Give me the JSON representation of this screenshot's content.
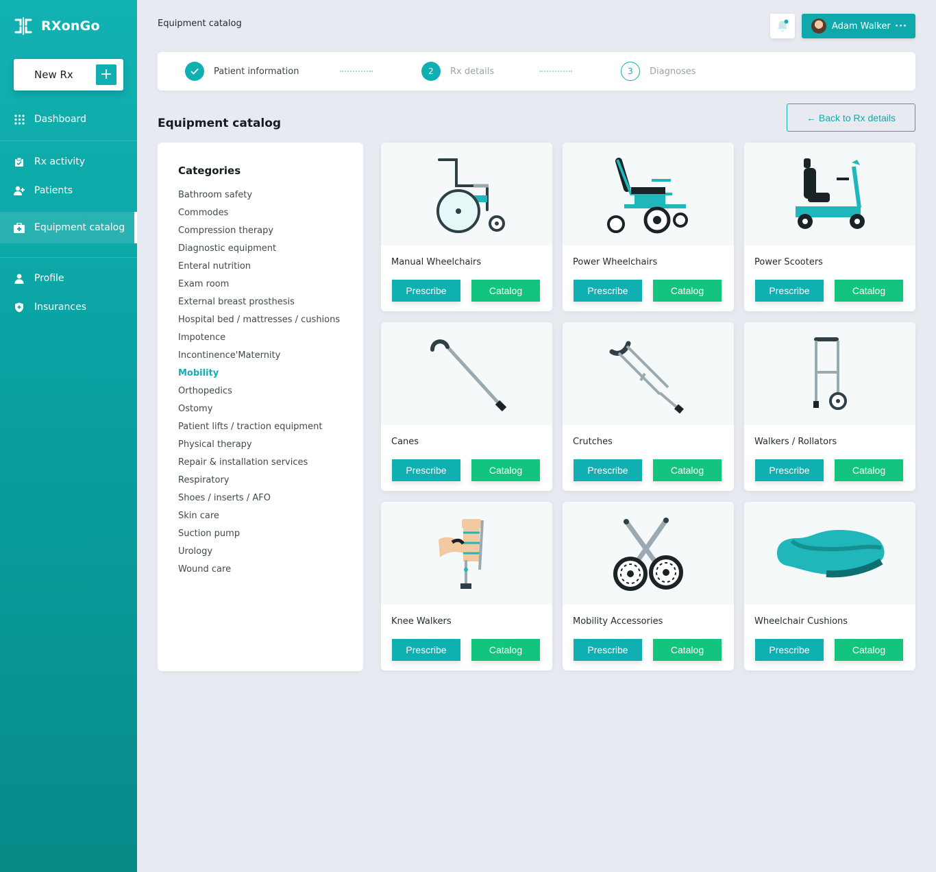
{
  "brand": {
    "name": "RXonGo"
  },
  "sidebar": {
    "new_rx_label": "New Rx",
    "items": [
      {
        "label": "Dashboard",
        "icon": "grid-icon"
      },
      {
        "label": "Rx activity",
        "icon": "clipboard-icon"
      },
      {
        "label": "Patients",
        "icon": "user-plus-icon"
      },
      {
        "label": "Equipment catalog",
        "icon": "medkit-icon",
        "active": true
      },
      {
        "label": "Profile",
        "icon": "user-icon"
      },
      {
        "label": "Insurances",
        "icon": "shield-icon"
      }
    ]
  },
  "header": {
    "breadcrumb": "Equipment catalog",
    "user_name": "Adam Walker",
    "user_menu": "···"
  },
  "stepper": {
    "steps": [
      {
        "number": "✓",
        "label": "Patient information",
        "state": "done"
      },
      {
        "number": "2",
        "label": "Rx details",
        "state": "current"
      },
      {
        "number": "3",
        "label": "Diagnoses",
        "state": "next"
      }
    ]
  },
  "main": {
    "title": "Equipment catalog",
    "back_label": "← Back to Rx details"
  },
  "categories": {
    "title": "Categories",
    "items": [
      "Bathroom safety",
      "Commodes",
      "Compression therapy",
      "Diagnostic equipment",
      "Enteral nutrition",
      "Exam room",
      "External breast prosthesis",
      "Hospital bed / mattresses / cushions",
      "Impotence",
      "Incontinence'Maternity",
      "Mobility",
      "Orthopedics",
      "Ostomy",
      "Patient lifts / traction equipment",
      "Physical therapy",
      "Repair & installation services",
      "Respiratory",
      "Shoes / inserts / AFO",
      "Skin care",
      "Suction pump",
      "Urology",
      "Wound care"
    ],
    "active": "Mobility"
  },
  "products": {
    "prescribe_label": "Prescribe",
    "catalog_label": "Catalog",
    "items": [
      {
        "title": "Manual Wheelchairs",
        "icon": "manual-wheelchair-icon"
      },
      {
        "title": "Power Wheelchairs",
        "icon": "power-wheelchair-icon"
      },
      {
        "title": "Power Scooters",
        "icon": "power-scooter-icon"
      },
      {
        "title": "Canes",
        "icon": "cane-icon"
      },
      {
        "title": "Crutches",
        "icon": "crutch-icon"
      },
      {
        "title": "Walkers / Rollators",
        "icon": "walker-icon"
      },
      {
        "title": "Knee Walkers",
        "icon": "knee-walker-icon"
      },
      {
        "title": "Mobility Accessories",
        "icon": "mobility-accessories-icon"
      },
      {
        "title": "Wheelchair Cushions",
        "icon": "wheelchair-cushion-icon"
      }
    ]
  },
  "colors": {
    "primary": "#10b0b2",
    "catalog_green": "#12c47e",
    "background": "#e8eaf1"
  }
}
